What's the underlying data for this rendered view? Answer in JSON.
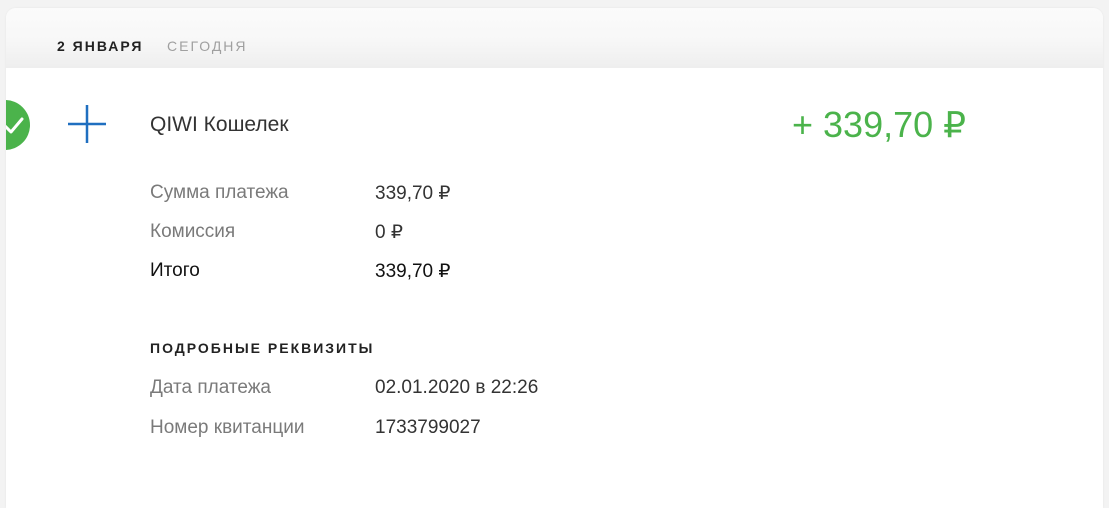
{
  "header": {
    "date": "2 ЯНВАРЯ",
    "relative": "СЕГОДНЯ"
  },
  "transaction": {
    "status_icon": "check-icon",
    "type_icon": "plus-icon",
    "provider": "QIWI Кошелек",
    "amount": "+ 339,70 ₽",
    "colors": {
      "success": "#4bb34b",
      "plus": "#1f6fc0"
    }
  },
  "summary": [
    {
      "label": "Сумма платежа",
      "value": "339,70 ₽"
    },
    {
      "label": "Комиссия",
      "value": "0 ₽"
    },
    {
      "label": "Итого",
      "value": "339,70 ₽"
    }
  ],
  "details": {
    "title": "ПОДРОБНЫЕ РЕКВИЗИТЫ",
    "rows": [
      {
        "label": "Дата платежа",
        "value": "02.01.2020 в 22:26"
      },
      {
        "label": "Номер квитанции",
        "value": "1733799027"
      }
    ]
  }
}
